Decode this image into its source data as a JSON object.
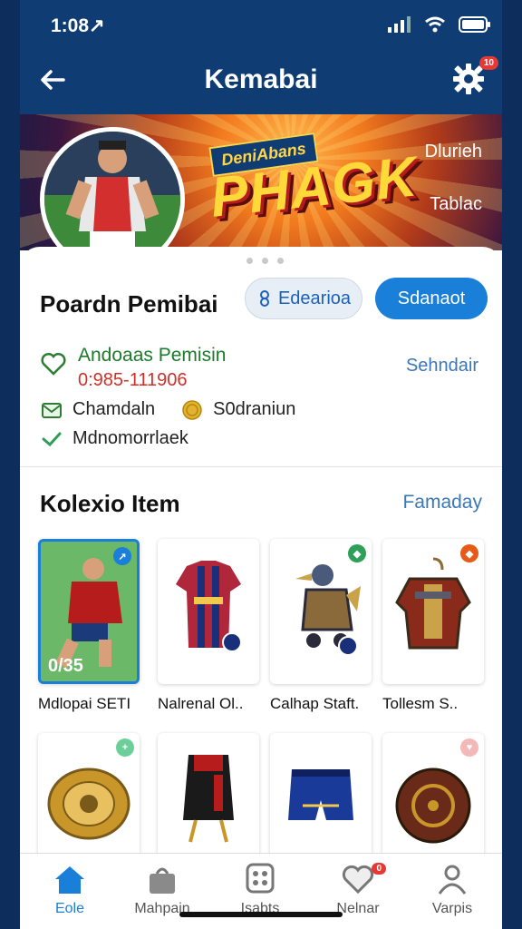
{
  "status": {
    "time": "1:08↗"
  },
  "appbar": {
    "title": "Kemabai",
    "badge": "10"
  },
  "banner": {
    "badge": "DeniAbans",
    "headline": "PHAGK",
    "side1": "Dlurieh",
    "side2": "Tablac"
  },
  "profile": {
    "section_title": "Poardn Pemibai",
    "btn_outline": "Edearioa",
    "btn_primary": "Sdanaot",
    "name": "Andoaas Pemisin",
    "phone": "0:985-111906",
    "link": "Sehndair",
    "rows": [
      "Chamdaln",
      "S0draniun",
      "Mdnomorrlaek"
    ]
  },
  "collection": {
    "section_title": "Kolexio Item",
    "see_all": "Famaday",
    "items": [
      {
        "label": "Mdlopai SETI",
        "overlay": "0/35"
      },
      {
        "label": "Nalrenal Ol.."
      },
      {
        "label": "Calhap Staft."
      },
      {
        "label": "Tollesm S.."
      },
      {
        "label": ""
      },
      {
        "label": ""
      },
      {
        "label": ""
      },
      {
        "label": ""
      }
    ]
  },
  "nav": {
    "items": [
      {
        "label": "Eole"
      },
      {
        "label": "Mahpain"
      },
      {
        "label": "Isabts"
      },
      {
        "label": "Nelnar",
        "badge": "0"
      },
      {
        "label": "Varpis"
      }
    ]
  },
  "colors": {
    "appbar": "#0f3c72",
    "accent": "#1a7fd8",
    "green": "#1c7a2a",
    "red": "#d0302a"
  }
}
